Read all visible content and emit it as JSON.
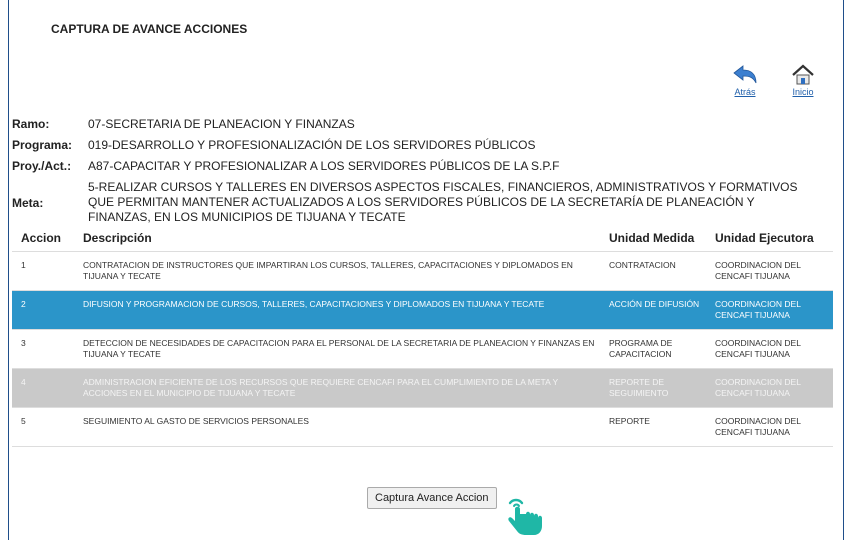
{
  "page_title": "CAPTURA DE AVANCE ACCIONES",
  "nav": {
    "back_label": "Atrás",
    "home_label": "Inicio",
    "back_icon": "back-arrow-icon",
    "home_icon": "home-icon"
  },
  "info": {
    "ramo_label": "Ramo:",
    "ramo_value": "07-SECRETARIA DE PLANEACION Y FINANZAS",
    "programa_label": "Programa:",
    "programa_value": "019-DESARROLLO Y PROFESIONALIZACIÓN DE LOS SERVIDORES PÚBLICOS",
    "proy_label": "Proy./Act.:",
    "proy_value": "A87-CAPACITAR Y PROFESIONALIZAR A LOS SERVIDORES PÚBLICOS DE LA S.P.F",
    "meta_label": "Meta:",
    "meta_value": "5-REALIZAR CURSOS Y TALLERES EN DIVERSOS ASPECTOS FISCALES, FINANCIEROS, ADMINISTRATIVOS Y FORMATIVOS QUE PERMITAN MANTENER ACTUALIZADOS A LOS SERVIDORES PÚBLICOS DE LA SECRETARÍA DE PLANEACIÓN Y FINANZAS, EN LOS MUNICIPIOS DE TIJUANA Y TECATE"
  },
  "table": {
    "headers": [
      "Accion",
      "Descripción",
      "Unidad Medida",
      "Unidad Ejecutora"
    ],
    "rows": [
      {
        "accion": "1",
        "descripcion": "CONTRATACION DE INSTRUCTORES QUE IMPARTIRAN LOS CURSOS, TALLERES, CAPACITACIONES Y DIPLOMADOS EN TIJUANA Y TECATE",
        "unidad_medida": "CONTRATACION",
        "unidad_ejecutora": "COORDINACION DEL CENCAFI TIJUANA"
      },
      {
        "accion": "2",
        "descripcion": "DIFUSION Y PROGRAMACION DE CURSOS, TALLERES, CAPACITACIONES Y DIPLOMADOS EN TIJUANA Y TECATE",
        "unidad_medida": "ACCIÓN DE DIFUSIÓN",
        "unidad_ejecutora": "COORDINACION DEL CENCAFI TIJUANA"
      },
      {
        "accion": "3",
        "descripcion": "DETECCION DE NECESIDADES DE CAPACITACION PARA EL PERSONAL DE LA SECRETARIA DE PLANEACION Y FINANZAS EN TIJUANA Y TECATE",
        "unidad_medida": "PROGRAMA DE CAPACITACION",
        "unidad_ejecutora": "COORDINACION DEL CENCAFI TIJUANA"
      },
      {
        "accion": "4",
        "descripcion": "ADMINISTRACION EFICIENTE DE LOS RECURSOS QUE REQUIERE CENCAFI PARA EL CUMPLIMIENTO DE LA META Y ACCIONES EN EL MUNICIPIO DE TIJUANA Y TECATE",
        "unidad_medida": "REPORTE DE SEGUIMIENTO",
        "unidad_ejecutora": "COORDINACION DEL CENCAFI TIJUANA"
      },
      {
        "accion": "5",
        "descripcion": "SEGUIMIENTO AL GASTO DE SERVICIOS PERSONALES",
        "unidad_medida": "REPORTE",
        "unidad_ejecutora": "COORDINACION DEL CENCAFI TIJUANA"
      }
    ]
  },
  "capture_button_label": "Captura Avance Accion",
  "colors": {
    "selected_row": "#2b95c9",
    "dimmed_row": "#c9c9c9",
    "hand_cursor": "#1fb7a6"
  }
}
